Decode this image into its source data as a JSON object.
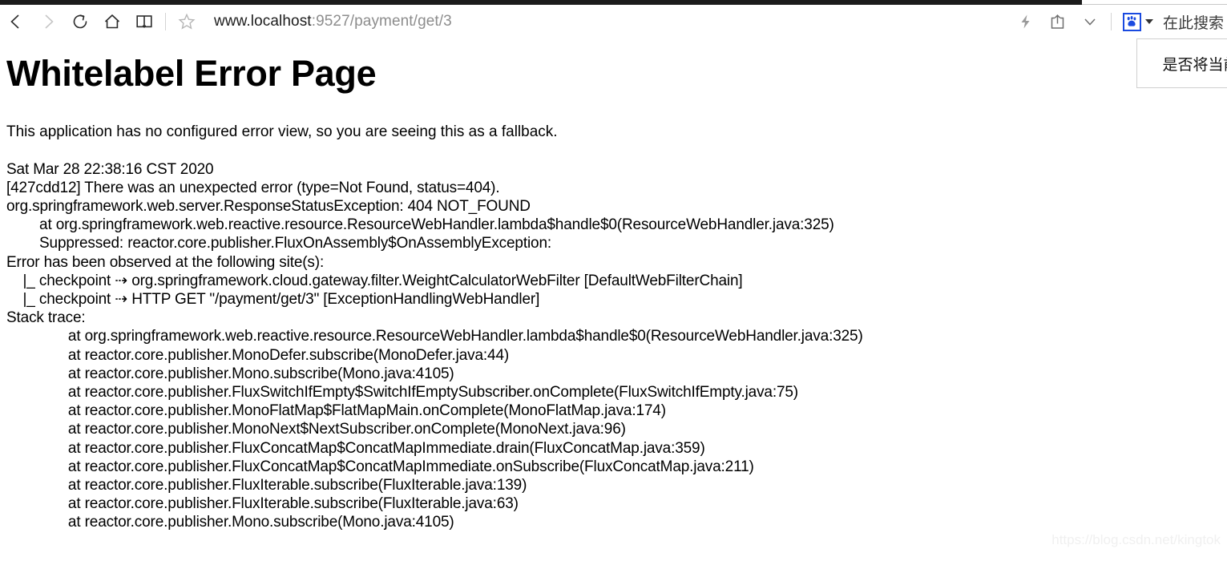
{
  "browser": {
    "toolbar": {
      "back_icon": "back-arrow-icon",
      "forward_icon": "forward-arrow-icon",
      "refresh_icon": "refresh-icon",
      "home_icon": "home-icon",
      "reading_list_icon": "book-icon",
      "favorite_icon": "star-icon",
      "lightning_icon": "lightning-bolt-icon",
      "share_icon": "share-icon",
      "more_icon": "chevron-down-icon",
      "baidu_icon": "baidu-paw-icon",
      "search_here_label": "在此搜索"
    },
    "address_bar": {
      "url_host": "www.localhost",
      "url_path": ":9527/payment/get/3",
      "full_url": "www.localhost:9527/payment/get/3"
    },
    "popup": {
      "message": "是否将当前"
    },
    "colors": {
      "tabstrip": "#1b1b1b",
      "baidu_blue": "#1a4ae0",
      "url_host": "#1c1c1c",
      "url_path": "#8d8d8d"
    }
  },
  "page": {
    "title": "Whitelabel Error Page",
    "fallback_note": "This application has no configured error view, so you are seeing this as a fallback.",
    "trace": "Sat Mar 28 22:38:16 CST 2020\n[427cdd12] There was an unexpected error (type=Not Found, status=404).\norg.springframework.web.server.ResponseStatusException: 404 NOT_FOUND\n        at org.springframework.web.reactive.resource.ResourceWebHandler.lambda$handle$0(ResourceWebHandler.java:325)\n        Suppressed: reactor.core.publisher.FluxOnAssembly$OnAssemblyException: \nError has been observed at the following site(s):\n    |_ checkpoint ⇢ org.springframework.cloud.gateway.filter.WeightCalculatorWebFilter [DefaultWebFilterChain]\n    |_ checkpoint ⇢ HTTP GET \"/payment/get/3\" [ExceptionHandlingWebHandler]\nStack trace:\n               at org.springframework.web.reactive.resource.ResourceWebHandler.lambda$handle$0(ResourceWebHandler.java:325)\n               at reactor.core.publisher.MonoDefer.subscribe(MonoDefer.java:44)\n               at reactor.core.publisher.Mono.subscribe(Mono.java:4105)\n               at reactor.core.publisher.FluxSwitchIfEmpty$SwitchIfEmptySubscriber.onComplete(FluxSwitchIfEmpty.java:75)\n               at reactor.core.publisher.MonoFlatMap$FlatMapMain.onComplete(MonoFlatMap.java:174)\n               at reactor.core.publisher.MonoNext$NextSubscriber.onComplete(MonoNext.java:96)\n               at reactor.core.publisher.FluxConcatMap$ConcatMapImmediate.drain(FluxConcatMap.java:359)\n               at reactor.core.publisher.FluxConcatMap$ConcatMapImmediate.onSubscribe(FluxConcatMap.java:211)\n               at reactor.core.publisher.FluxIterable.subscribe(FluxIterable.java:139)\n               at reactor.core.publisher.FluxIterable.subscribe(FluxIterable.java:63)\n               at reactor.core.publisher.Mono.subscribe(Mono.java:4105)",
    "timestamp": "Sat Mar 28 22:38:16 CST 2020",
    "error_id": "[427cdd12]",
    "error_summary": "There was an unexpected error (type=Not Found, status=404).",
    "exception": "org.springframework.web.server.ResponseStatusException: 404 NOT_FOUND",
    "status_code": "404",
    "status_type": "Not Found",
    "watermark": "https://blog.csdn.net/kingtok"
  }
}
